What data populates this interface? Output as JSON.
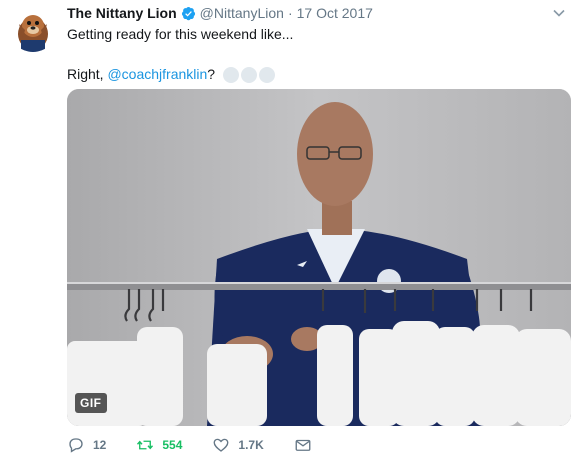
{
  "tweet": {
    "author_name": "The Nittany Lion",
    "verified": true,
    "handle": "@NittanyLion",
    "separator": "·",
    "date": "17 Oct 2017",
    "text_line1": "Getting ready for this weekend like...",
    "text_line2_prefix": "Right, ",
    "mention": "@coachjfranklin",
    "text_line2_suffix": "?",
    "media": {
      "badge": "GIF"
    },
    "actions": {
      "replies": "12",
      "retweets": "554",
      "likes": "1.7K"
    }
  },
  "colors": {
    "link": "#1b95e0",
    "retweet_active": "#17bf63",
    "secondary_text": "#657786"
  }
}
